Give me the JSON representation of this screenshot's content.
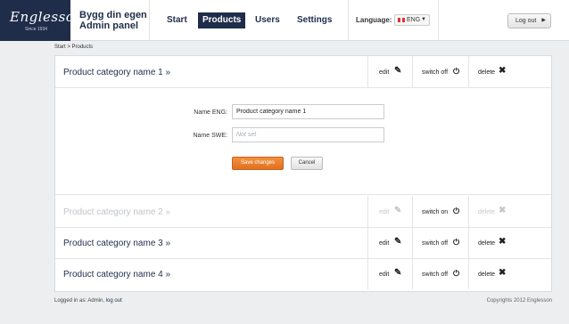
{
  "brand": {
    "logo_text": "Englesson",
    "logo_since": "Since 1934",
    "line1": "Bygg din egen",
    "line2": "Admin panel"
  },
  "nav": {
    "items": [
      {
        "label": "Start",
        "active": false
      },
      {
        "label": "Products",
        "active": true
      },
      {
        "label": "Users",
        "active": false
      },
      {
        "label": "Settings",
        "active": false
      }
    ]
  },
  "language": {
    "label": "Language:",
    "selected": "ENG"
  },
  "logout_button": "Log out",
  "breadcrumb": "Start > Products",
  "products": [
    {
      "name": "Product category name 1 »",
      "edit": "edit",
      "switch": "switch off",
      "delete": "delete",
      "enabled": true,
      "expanded": true
    },
    {
      "name": "Product category name 2 »",
      "edit": "edit",
      "switch": "switch on",
      "delete": "delete",
      "enabled": false,
      "expanded": false
    },
    {
      "name": "Product category name 3 »",
      "edit": "edit",
      "switch": "switch off",
      "delete": "delete",
      "enabled": true,
      "expanded": false
    },
    {
      "name": "Product category name 4 »",
      "edit": "edit",
      "switch": "switch off",
      "delete": "delete",
      "enabled": true,
      "expanded": false
    }
  ],
  "edit_form": {
    "name_eng_label": "Name ENG:",
    "name_eng_value": "Product category name 1",
    "name_swe_label": "Name SWE:",
    "name_swe_placeholder": "Not set",
    "save_label": "Save changes",
    "cancel_label": "Cancel"
  },
  "footer": {
    "logged_in_prefix": "Logged in as: Admin,",
    "logout_link": "log out",
    "copyright": "Copyrights 2012 Englesson"
  },
  "colors": {
    "brand_navy": "#1f2d4a",
    "accent_orange": "#e87f2c",
    "disabled_text": "#c0c4c9"
  }
}
